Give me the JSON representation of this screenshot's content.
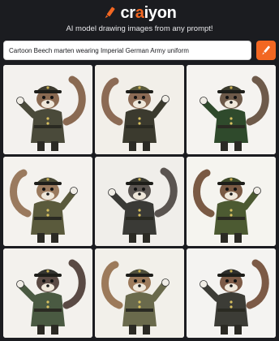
{
  "brand": {
    "name_pre": "cr",
    "name_dot": "a",
    "name_post": "iyon"
  },
  "tagline": "AI model drawing images from any prompt!",
  "search": {
    "value": "Cartoon Beech marten wearing Imperial German Army uniform"
  },
  "colors": {
    "accent": "#f26722",
    "background": "#1b1c20"
  },
  "icons": {
    "logo": "pencil-icon",
    "draw_button": "pencil-icon"
  },
  "images": [
    {
      "bg": "#f3f1ee",
      "uniform": "#4a4a3a",
      "fur": "#8a6a52",
      "hat": "#3d3b30"
    },
    {
      "bg": "#f2efe9",
      "uniform": "#3b3a2e",
      "fur": "#8c6b55",
      "hat": "#5a5a3c"
    },
    {
      "bg": "#f5f3f0",
      "uniform": "#2f4a2c",
      "fur": "#6e5a4a",
      "hat": "#3c3c2e"
    },
    {
      "bg": "#f4f2ee",
      "uniform": "#5a5a3c",
      "fur": "#9a7a5e",
      "hat": "#4a4a36"
    },
    {
      "bg": "#f0eeea",
      "uniform": "#3a3a36",
      "fur": "#5a5450",
      "hat": "#3a3a32"
    },
    {
      "bg": "#f5f4ef",
      "uniform": "#4c5a32",
      "fur": "#7a5a44",
      "hat": "#3e4a2a"
    },
    {
      "bg": "#f3f1ed",
      "uniform": "#4a5a42",
      "fur": "#5a4a44",
      "hat": "#343430"
    },
    {
      "bg": "#f2f0ea",
      "uniform": "#6a6a4c",
      "fur": "#9c7a5a",
      "hat": "#4e4e3a"
    },
    {
      "bg": "#f4f3f1",
      "uniform": "#3c3c36",
      "fur": "#7c5a46",
      "hat": "#2e2e2c"
    }
  ]
}
